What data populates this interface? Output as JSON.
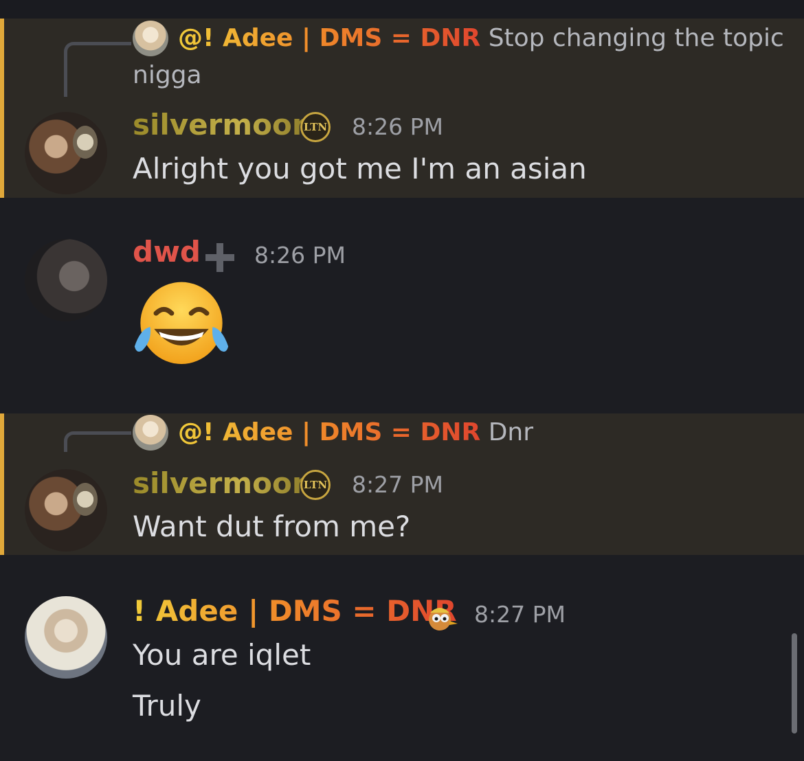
{
  "messages": [
    {
      "reply": {
        "name": "@! Adee | DMS = DNR",
        "text_line1": "Stop changing the topic",
        "text_line2": "nigga"
      },
      "author": "silvermoon",
      "badge": "LTN",
      "time": "8:26 PM",
      "text": "Alright you got me I'm an asian",
      "highlighted": true
    },
    {
      "author": "dwd",
      "badge_icon": "plus-icon",
      "time": "8:26 PM",
      "emoji": "face-with-tears-of-joy-icon"
    },
    {
      "reply": {
        "name": "@! Adee | DMS = DNR",
        "text_line1": "Dnr"
      },
      "author": "silvermoon",
      "badge": "LTN",
      "time": "8:27 PM",
      "text": "Want dut from me?",
      "highlighted": true
    },
    {
      "author": "! Adee | DMS = DNR",
      "badge_icon": "cartoon-bird-icon",
      "time": "8:27 PM",
      "lines": [
        "You are iqlet",
        "Truly"
      ]
    }
  ],
  "colors": {
    "background": "#1c1d22",
    "highlight_bg": "#2d2a25",
    "highlight_bar": "#e0a83a",
    "name_dwd": "#e0544a",
    "timestamp": "#9ea0a6"
  }
}
